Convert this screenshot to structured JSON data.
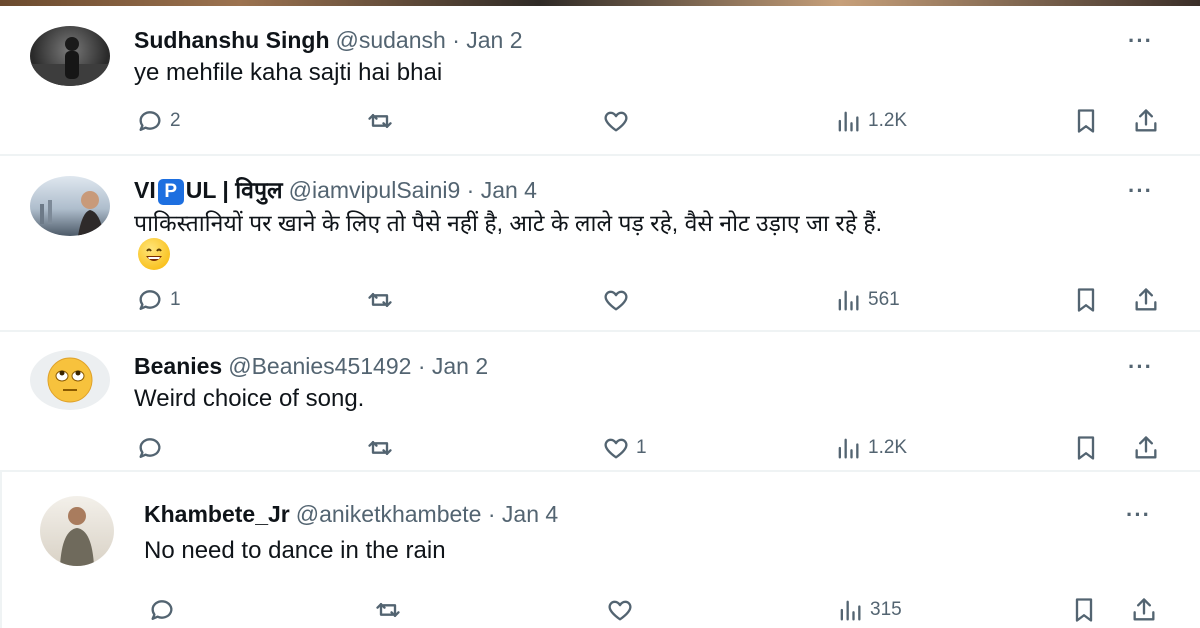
{
  "replies": [
    {
      "name": "Sudhanshu Singh",
      "meta": "@sudansh · Jan 2",
      "text": "ye mehfile kaha sajti hai bhai",
      "more": "···",
      "replies": "2",
      "retweets": "",
      "likes": "",
      "views": "1.2K"
    },
    {
      "name_pre": "VI",
      "name_badge": "P",
      "name_post": "UL | विपुल",
      "meta": "@iamvipulSaini9 · Jan 4",
      "text": "पाकिस्तानियों पर खाने के लिए तो पैसे नहीं है, आटे के लाले पड़ रहे, वैसे नोट उड़ाए जा रहे हैं.",
      "more": "···",
      "replies": "1",
      "retweets": "",
      "likes": "",
      "views": "561"
    },
    {
      "name": "Beanies",
      "meta": "@Beanies451492 · Jan 2",
      "text": "Weird choice of song.",
      "more": "···",
      "replies": "",
      "retweets": "",
      "likes": "1",
      "views": "1.2K"
    },
    {
      "name": "Khambete_Jr",
      "meta": "@aniketkhambete · Jan 4",
      "text": "No need to dance in the rain",
      "more": "···",
      "replies": "",
      "retweets": "",
      "likes": "",
      "views": "315"
    }
  ],
  "icons": {
    "reply": "reply-icon",
    "retweet": "retweet-icon",
    "like": "heart-icon",
    "views": "views-icon",
    "bookmark": "bookmark-icon",
    "share": "share-icon",
    "more": "more-icon"
  },
  "colors": {
    "secondary_text": "#536471",
    "primary_text": "#0f1419",
    "divider": "#eff3f4",
    "badge": "#1d6fe0"
  }
}
